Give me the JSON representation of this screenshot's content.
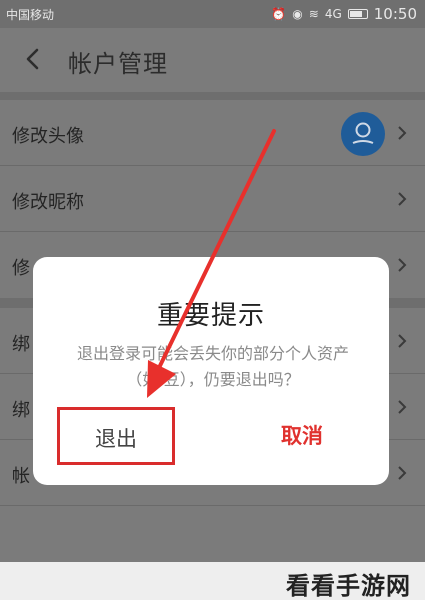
{
  "status_bar": {
    "carrier": "中国移动",
    "signal_text": "4G",
    "time": "10:50"
  },
  "header": {
    "title": "帐户管理",
    "back_icon": "chevron-left-icon"
  },
  "rows": [
    {
      "label": "修改头像",
      "has_avatar": true
    },
    {
      "label": "修改昵称"
    },
    {
      "label": "修"
    },
    {
      "label": "绑"
    },
    {
      "label": "绑"
    },
    {
      "label": "帐"
    }
  ],
  "dialog": {
    "title": "重要提示",
    "message": "退出登录可能会丢失你的部分个人资产（如:豆），仍要退出吗？",
    "confirm_label": "退出",
    "cancel_label": "取消"
  },
  "colors": {
    "accent_red": "#e0312e",
    "avatar_blue": "#1f5c99",
    "dim_overlay": "#7b7b7b"
  },
  "watermark": "看看手游网"
}
